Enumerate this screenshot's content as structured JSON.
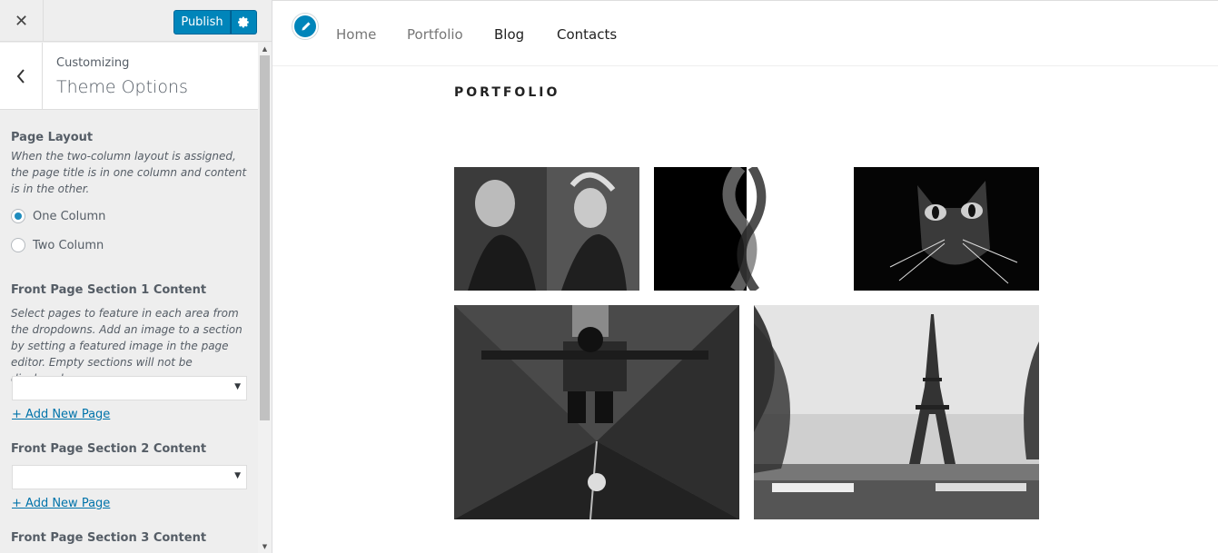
{
  "topbar": {
    "close_icon": "close-icon",
    "publish_label": "Publish",
    "gear_icon": "gear-icon"
  },
  "section": {
    "back_icon": "back-arrow-icon",
    "crumb": "Customizing",
    "title": "Theme Options"
  },
  "controls": {
    "page_layout": {
      "title": "Page Layout",
      "description": "When the two-column layout is assigned, the page title is in one column and content is in the other.",
      "options": [
        "One Column",
        "Two Column"
      ],
      "selected": "One Column"
    },
    "section1": {
      "title": "Front Page Section 1 Content",
      "description": "Select pages to feature in each area from the dropdowns. Add an image to a section by setting a featured image in the page editor. Empty sections will not be displayed.",
      "select_value": "",
      "add_link": "+ Add New Page"
    },
    "section2": {
      "title": "Front Page Section 2 Content",
      "select_value": "",
      "add_link": "+ Add New Page"
    },
    "section3": {
      "title": "Front Page Section 3 Content"
    }
  },
  "preview": {
    "nav": [
      "Home",
      "Portfolio",
      "Blog",
      "Contacts"
    ],
    "heading": "PORTFOLIO",
    "edit_icon": "pencil-icon",
    "accent": "#0085ba"
  }
}
